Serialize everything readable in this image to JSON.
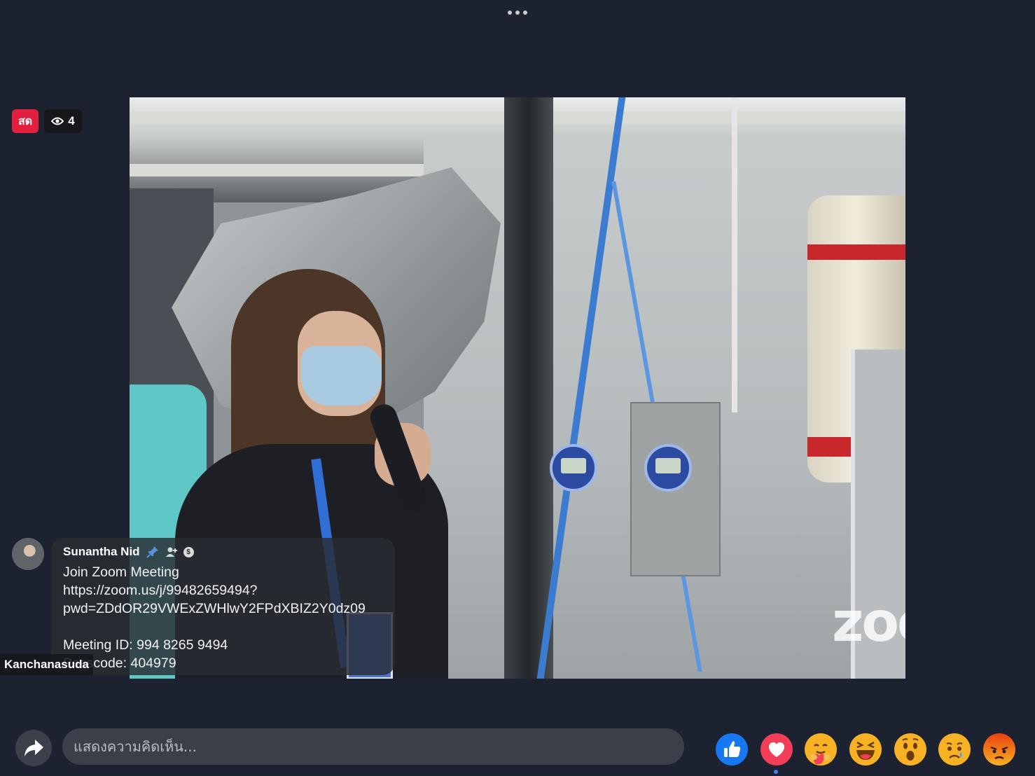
{
  "live": {
    "badge_label": "สด",
    "viewer_count": "4"
  },
  "comment": {
    "author": "Sunantha Nid",
    "text": "Join Zoom Meeting\nhttps://zoom.us/j/99482659494?\npwd=ZDdOR29VWExZWHlwY2FPdXBIZ2Y0dz09\n\nMeeting ID: 994 8265 9494\nPasscode: 404979",
    "badges": [
      "pin-icon",
      "person-plus-icon",
      "stars-icon"
    ]
  },
  "video": {
    "host_name": "Kanchanasuda",
    "watermark": "zoom"
  },
  "composer": {
    "placeholder": "แสดงความคิดเห็น..."
  },
  "reactions": [
    "like-icon",
    "love-icon",
    "care-icon",
    "haha-icon",
    "wow-icon",
    "sad-icon",
    "angry-icon"
  ],
  "colors": {
    "live_red": "#e41e3f",
    "like_blue": "#1877f2",
    "love_red": "#f33e58",
    "emoji_yellow": "#f7b125",
    "angry_orange": "#e9710f"
  }
}
